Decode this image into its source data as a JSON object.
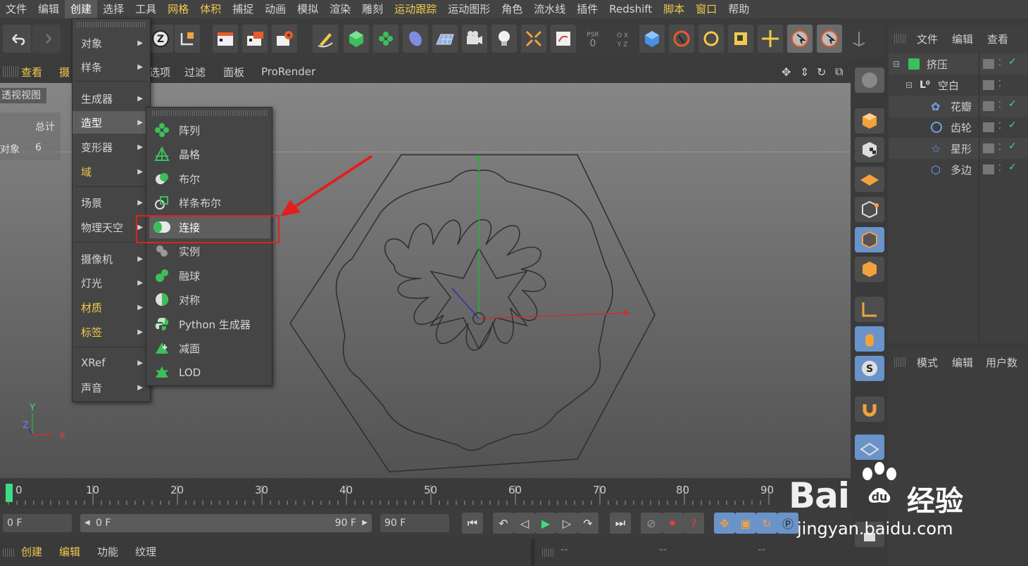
{
  "menubar": [
    "文件",
    "编辑",
    "创建",
    "选择",
    "工具",
    "网格",
    "体积",
    "捕捉",
    "动画",
    "模拟",
    "渲染",
    "雕刻",
    "运动跟踪",
    "运动图形",
    "角色",
    "流水线",
    "插件",
    "Redshift",
    "脚本",
    "窗口",
    "帮助"
  ],
  "viewport": {
    "menus": [
      "查看",
      "摄",
      "选项",
      "过滤",
      "面板",
      "ProRender"
    ],
    "label": "透视视图",
    "stats_header": "总计",
    "stats_label": "对象",
    "stats_value": "6",
    "axis_y": "Y",
    "axis_z": "Z",
    "axis_x": "X"
  },
  "create_menu": [
    {
      "label": "对象",
      "arrow": true
    },
    {
      "label": "样条",
      "arrow": true
    },
    {
      "label": "生成器",
      "arrow": true
    },
    {
      "label": "造型",
      "arrow": true
    },
    {
      "label": "变形器",
      "arrow": true
    },
    {
      "label": "域",
      "arrow": true
    },
    {
      "label": "场景",
      "arrow": true
    },
    {
      "label": "物理天空",
      "arrow": true
    },
    {
      "label": "摄像机",
      "arrow": true
    },
    {
      "label": "灯光",
      "arrow": true
    },
    {
      "label": "材质",
      "arrow": true
    },
    {
      "label": "标签",
      "arrow": true
    },
    {
      "label": "XRef",
      "arrow": true
    },
    {
      "label": "声音",
      "arrow": true
    }
  ],
  "submenu": [
    {
      "label": "阵列",
      "icon": "cloner-icon"
    },
    {
      "label": "晶格",
      "icon": "lattice-icon"
    },
    {
      "label": "布尔",
      "icon": "boole-icon"
    },
    {
      "label": "样条布尔",
      "icon": "spline-boole-icon"
    },
    {
      "label": "连接",
      "icon": "connect-icon"
    },
    {
      "label": "实例",
      "icon": "instance-icon"
    },
    {
      "label": "融球",
      "icon": "metaball-icon"
    },
    {
      "label": "对称",
      "icon": "symmetry-icon"
    },
    {
      "label": "Python 生成器",
      "icon": "python-icon"
    },
    {
      "label": "减面",
      "icon": "polygon-reduction-icon"
    },
    {
      "label": "LOD",
      "icon": "lod-icon"
    }
  ],
  "object_manager": {
    "menus": [
      "文件",
      "编辑",
      "查看"
    ],
    "objects": [
      {
        "name": "挤压"
      },
      {
        "name": "空白"
      },
      {
        "name": "花瓣"
      },
      {
        "name": "齿轮"
      },
      {
        "name": "星形"
      },
      {
        "name": "多边"
      }
    ]
  },
  "attributes": {
    "menus": [
      "模式",
      "编辑",
      "用户数"
    ]
  },
  "timeline": {
    "ticks": [
      "0",
      "10",
      "20",
      "30",
      "40",
      "50",
      "60",
      "70",
      "80",
      "90"
    ],
    "start_field": "0 F",
    "range_start": "0 F",
    "range_end": "90 F",
    "end_field": "90 F"
  },
  "bottom": {
    "menus": [
      "创建",
      "编辑",
      "功能",
      "纹理"
    ],
    "dashes": [
      "--",
      "--",
      "--"
    ]
  },
  "watermark": {
    "brand": "Bai",
    "brand_right": "经验",
    "url": "jingyan.baidu.com"
  },
  "colors": {
    "accent": "#f2c94c",
    "highlight_box": "#e02020",
    "arrow": "#e02020",
    "green": "#3ddc84"
  }
}
